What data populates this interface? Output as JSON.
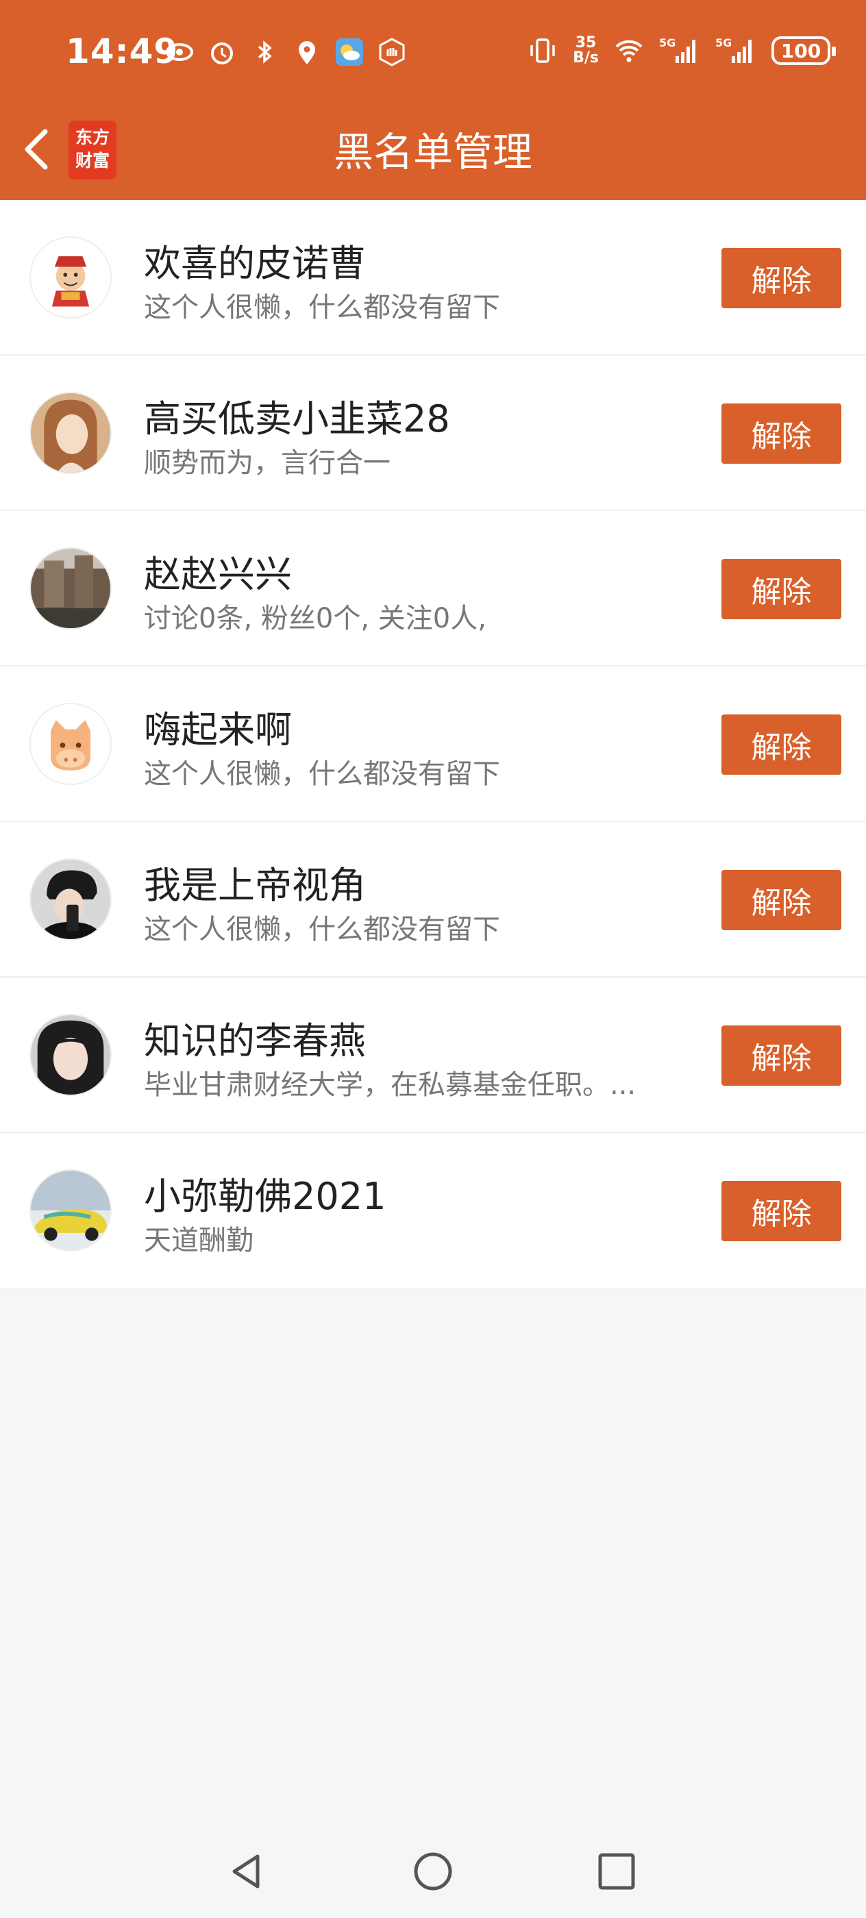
{
  "status_bar": {
    "time": "14:49",
    "net_speed_top": "35",
    "net_speed_bottom": "B/s",
    "signal1": "5G",
    "signal2": "5G",
    "battery": "100"
  },
  "header": {
    "logo_line1": "东方",
    "logo_line2": "财富",
    "title": "黑名单管理",
    "accent_color": "#d9602a"
  },
  "blacklist": [
    {
      "name": "欢喜的皮诺曹",
      "desc": "这个人很懒，什么都没有留下",
      "button": "解除",
      "avatar": "财神图案"
    },
    {
      "name": "高买低卖小韭菜28",
      "desc": "顺势而为，言行合一",
      "button": "解除",
      "avatar": "女士头像"
    },
    {
      "name": "赵赵兴兴",
      "desc": "讨论0条, 粉丝0个, 关注0人,",
      "button": "解除",
      "avatar": "建筑照片"
    },
    {
      "name": "嗨起来啊",
      "desc": "这个人很懒，什么都没有留下",
      "button": "解除",
      "avatar": "卡通马"
    },
    {
      "name": "我是上帝视角",
      "desc": "这个人很懒，什么都没有留下",
      "button": "解除",
      "avatar": "男士自拍"
    },
    {
      "name": "知识的李春燕",
      "desc": "毕业甘肃财经大学，在私募基金任职。...",
      "button": "解除",
      "avatar": "女士自拍"
    },
    {
      "name": "小弥勒佛2021",
      "desc": "天道酬勤",
      "button": "解除",
      "avatar": "跑车照片"
    }
  ]
}
